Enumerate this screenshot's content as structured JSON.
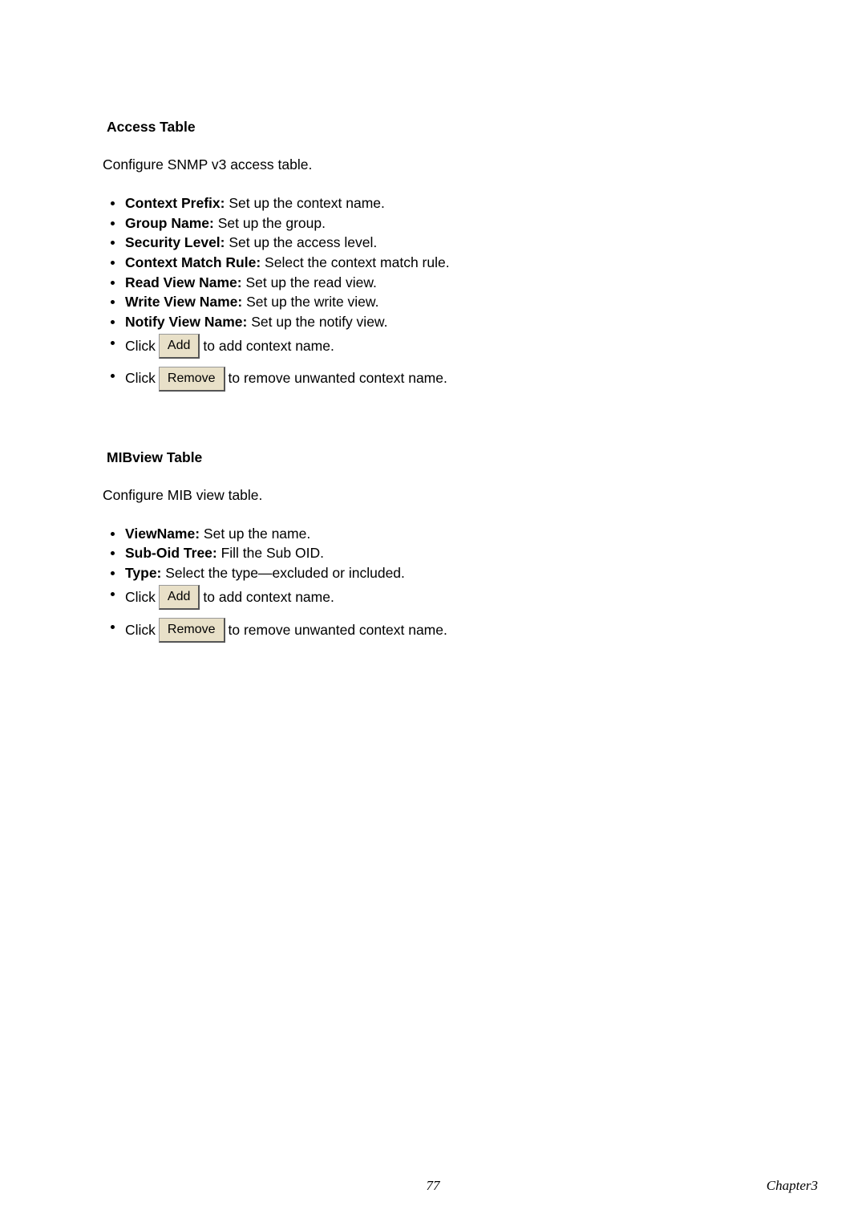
{
  "section1": {
    "heading": "Access Table",
    "intro": "Configure SNMP v3 access table.",
    "items": [
      {
        "label": "Context Prefix:",
        "text": " Set up the context name."
      },
      {
        "label": "Group Name:",
        "text": " Set up the group."
      },
      {
        "label": "Security Level:",
        "text": " Set up the access level."
      },
      {
        "label": "Context Match Rule:",
        "text": " Select the context match rule."
      },
      {
        "label": "Read View Name:",
        "text": " Set up the read view."
      },
      {
        "label": "Write View Name:",
        "text": " Set up the write view."
      },
      {
        "label": "Notify View Name:",
        "text": " Set up the notify view."
      }
    ],
    "add_prefix": "Click ",
    "add_button": "Add",
    "add_suffix": " to add context name.",
    "remove_prefix": "Click ",
    "remove_button": "Remove",
    "remove_suffix": " to remove unwanted context name."
  },
  "section2": {
    "heading": "MIBview Table",
    "intro": "Configure MIB view table.",
    "items": [
      {
        "label": "ViewName:",
        "text": " Set up the name."
      },
      {
        "label": "Sub-Oid Tree:",
        "text": " Fill the Sub OID."
      },
      {
        "label": "Type:",
        "text": " Select the type—excluded or included."
      }
    ],
    "add_prefix": "Click ",
    "add_button": "Add",
    "add_suffix": " to add context name.",
    "remove_prefix": "Click ",
    "remove_button": "Remove",
    "remove_suffix": " to remove unwanted context name."
  },
  "footer": {
    "page": "77",
    "chapter": "Chapter3"
  }
}
